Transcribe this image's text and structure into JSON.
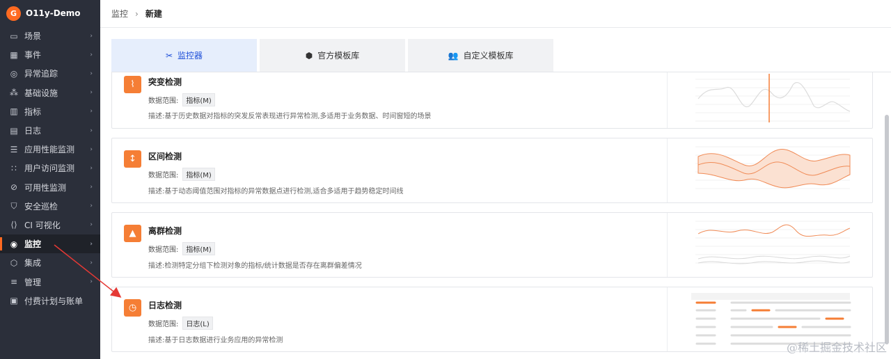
{
  "app": {
    "name": "O11y-Demo",
    "logo_letter": "G"
  },
  "sidebar": {
    "items": [
      {
        "label": "场景",
        "icon": "dashboard-icon"
      },
      {
        "label": "事件",
        "icon": "calendar-icon"
      },
      {
        "label": "异常追踪",
        "icon": "target-icon"
      },
      {
        "label": "基础设施",
        "icon": "infrastructure-icon"
      },
      {
        "label": "指标",
        "icon": "metrics-icon"
      },
      {
        "label": "日志",
        "icon": "log-icon"
      },
      {
        "label": "应用性能监测",
        "icon": "apm-icon"
      },
      {
        "label": "用户访问监测",
        "icon": "rum-icon"
      },
      {
        "label": "可用性监测",
        "icon": "availability-icon"
      },
      {
        "label": "安全巡检",
        "icon": "shield-icon"
      },
      {
        "label": "CI 可视化",
        "icon": "ci-icon"
      },
      {
        "label": "监控",
        "icon": "monitor-icon",
        "active": true
      },
      {
        "label": "集成",
        "icon": "integration-icon"
      },
      {
        "label": "管理",
        "icon": "settings-icon"
      },
      {
        "label": "付费计划与账单",
        "icon": "billing-icon"
      }
    ]
  },
  "breadcrumb": {
    "parent": "监控",
    "separator": "›",
    "current": "新建"
  },
  "tabs": [
    {
      "label": "监控器",
      "icon": "tools-icon",
      "active": true
    },
    {
      "label": "官方模板库",
      "icon": "hexagon-icon"
    },
    {
      "label": "自定义模板库",
      "icon": "users-icon"
    }
  ],
  "cards": [
    {
      "title": "突变检测",
      "scope_label": "数据范围:",
      "scope_value": "指标(M)",
      "desc": "描述:基于历史数据对指标的突发反常表现进行异常检测,多适用于业务数据、时间窗短的场景",
      "icon": "mutation-icon"
    },
    {
      "title": "区间检测",
      "scope_label": "数据范围:",
      "scope_value": "指标(M)",
      "desc": "描述:基于动态阈值范围对指标的异常数据点进行检测,适合多适用于趋势稳定时间线",
      "icon": "range-icon"
    },
    {
      "title": "离群检测",
      "scope_label": "数据范围:",
      "scope_value": "指标(M)",
      "desc": "描述:检测特定分组下检测对象的指标/统计数据是否存在离群偏差情况",
      "icon": "outlier-icon"
    },
    {
      "title": "日志检测",
      "scope_label": "数据范围:",
      "scope_value": "日志(L)",
      "desc": "描述:基于日志数据进行业务应用的异常检测",
      "icon": "log-detect-icon"
    }
  ],
  "watermark": "@稀土掘金技术社区",
  "colors": {
    "accent": "#ff6a21",
    "sidebar_bg": "#2b2f3a",
    "active_tab_bg": "#e6eefc",
    "active_tab_text": "#1d4ed8",
    "arrow": "#e53935"
  }
}
